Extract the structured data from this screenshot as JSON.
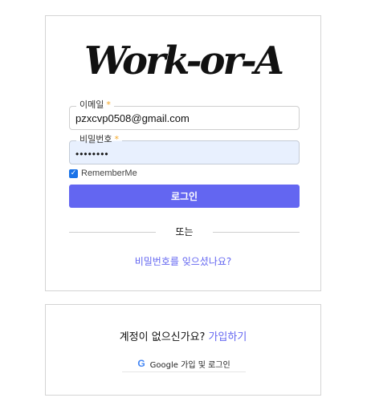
{
  "logo": {
    "text": "Work-or-A"
  },
  "login_form": {
    "email": {
      "label": "이메일",
      "required_mark": "*",
      "value": "pzxcvp0508@gmail.com"
    },
    "password": {
      "label": "비밀번호",
      "required_mark": "*",
      "value": "••••••••"
    },
    "remember": {
      "label": "RememberMe",
      "checked": true
    },
    "login_button": "로그인",
    "divider_text": "또는",
    "forgot_password": "비밀번호를 잊으셨나요?"
  },
  "signup": {
    "prompt": "계정이 없으신가요?",
    "link": "가입하기",
    "google_button": "Google 가입 및 로그인"
  },
  "colors": {
    "accent": "#6366f1",
    "autofill_bg": "#e8f0fe",
    "required": "#f5a623"
  }
}
